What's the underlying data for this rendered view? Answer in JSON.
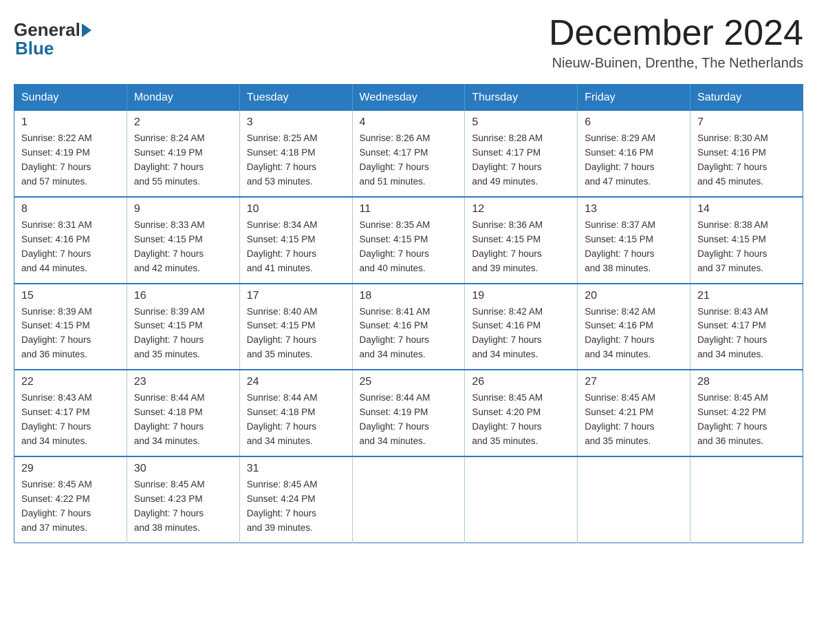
{
  "header": {
    "logo_general": "General",
    "logo_blue": "Blue",
    "month_title": "December 2024",
    "location": "Nieuw-Buinen, Drenthe, The Netherlands"
  },
  "weekdays": [
    "Sunday",
    "Monday",
    "Tuesday",
    "Wednesday",
    "Thursday",
    "Friday",
    "Saturday"
  ],
  "weeks": [
    [
      {
        "day": "1",
        "sunrise": "8:22 AM",
        "sunset": "4:19 PM",
        "daylight": "7 hours and 57 minutes."
      },
      {
        "day": "2",
        "sunrise": "8:24 AM",
        "sunset": "4:19 PM",
        "daylight": "7 hours and 55 minutes."
      },
      {
        "day": "3",
        "sunrise": "8:25 AM",
        "sunset": "4:18 PM",
        "daylight": "7 hours and 53 minutes."
      },
      {
        "day": "4",
        "sunrise": "8:26 AM",
        "sunset": "4:17 PM",
        "daylight": "7 hours and 51 minutes."
      },
      {
        "day": "5",
        "sunrise": "8:28 AM",
        "sunset": "4:17 PM",
        "daylight": "7 hours and 49 minutes."
      },
      {
        "day": "6",
        "sunrise": "8:29 AM",
        "sunset": "4:16 PM",
        "daylight": "7 hours and 47 minutes."
      },
      {
        "day": "7",
        "sunrise": "8:30 AM",
        "sunset": "4:16 PM",
        "daylight": "7 hours and 45 minutes."
      }
    ],
    [
      {
        "day": "8",
        "sunrise": "8:31 AM",
        "sunset": "4:16 PM",
        "daylight": "7 hours and 44 minutes."
      },
      {
        "day": "9",
        "sunrise": "8:33 AM",
        "sunset": "4:15 PM",
        "daylight": "7 hours and 42 minutes."
      },
      {
        "day": "10",
        "sunrise": "8:34 AM",
        "sunset": "4:15 PM",
        "daylight": "7 hours and 41 minutes."
      },
      {
        "day": "11",
        "sunrise": "8:35 AM",
        "sunset": "4:15 PM",
        "daylight": "7 hours and 40 minutes."
      },
      {
        "day": "12",
        "sunrise": "8:36 AM",
        "sunset": "4:15 PM",
        "daylight": "7 hours and 39 minutes."
      },
      {
        "day": "13",
        "sunrise": "8:37 AM",
        "sunset": "4:15 PM",
        "daylight": "7 hours and 38 minutes."
      },
      {
        "day": "14",
        "sunrise": "8:38 AM",
        "sunset": "4:15 PM",
        "daylight": "7 hours and 37 minutes."
      }
    ],
    [
      {
        "day": "15",
        "sunrise": "8:39 AM",
        "sunset": "4:15 PM",
        "daylight": "7 hours and 36 minutes."
      },
      {
        "day": "16",
        "sunrise": "8:39 AM",
        "sunset": "4:15 PM",
        "daylight": "7 hours and 35 minutes."
      },
      {
        "day": "17",
        "sunrise": "8:40 AM",
        "sunset": "4:15 PM",
        "daylight": "7 hours and 35 minutes."
      },
      {
        "day": "18",
        "sunrise": "8:41 AM",
        "sunset": "4:16 PM",
        "daylight": "7 hours and 34 minutes."
      },
      {
        "day": "19",
        "sunrise": "8:42 AM",
        "sunset": "4:16 PM",
        "daylight": "7 hours and 34 minutes."
      },
      {
        "day": "20",
        "sunrise": "8:42 AM",
        "sunset": "4:16 PM",
        "daylight": "7 hours and 34 minutes."
      },
      {
        "day": "21",
        "sunrise": "8:43 AM",
        "sunset": "4:17 PM",
        "daylight": "7 hours and 34 minutes."
      }
    ],
    [
      {
        "day": "22",
        "sunrise": "8:43 AM",
        "sunset": "4:17 PM",
        "daylight": "7 hours and 34 minutes."
      },
      {
        "day": "23",
        "sunrise": "8:44 AM",
        "sunset": "4:18 PM",
        "daylight": "7 hours and 34 minutes."
      },
      {
        "day": "24",
        "sunrise": "8:44 AM",
        "sunset": "4:18 PM",
        "daylight": "7 hours and 34 minutes."
      },
      {
        "day": "25",
        "sunrise": "8:44 AM",
        "sunset": "4:19 PM",
        "daylight": "7 hours and 34 minutes."
      },
      {
        "day": "26",
        "sunrise": "8:45 AM",
        "sunset": "4:20 PM",
        "daylight": "7 hours and 35 minutes."
      },
      {
        "day": "27",
        "sunrise": "8:45 AM",
        "sunset": "4:21 PM",
        "daylight": "7 hours and 35 minutes."
      },
      {
        "day": "28",
        "sunrise": "8:45 AM",
        "sunset": "4:22 PM",
        "daylight": "7 hours and 36 minutes."
      }
    ],
    [
      {
        "day": "29",
        "sunrise": "8:45 AM",
        "sunset": "4:22 PM",
        "daylight": "7 hours and 37 minutes."
      },
      {
        "day": "30",
        "sunrise": "8:45 AM",
        "sunset": "4:23 PM",
        "daylight": "7 hours and 38 minutes."
      },
      {
        "day": "31",
        "sunrise": "8:45 AM",
        "sunset": "4:24 PM",
        "daylight": "7 hours and 39 minutes."
      },
      null,
      null,
      null,
      null
    ]
  ]
}
